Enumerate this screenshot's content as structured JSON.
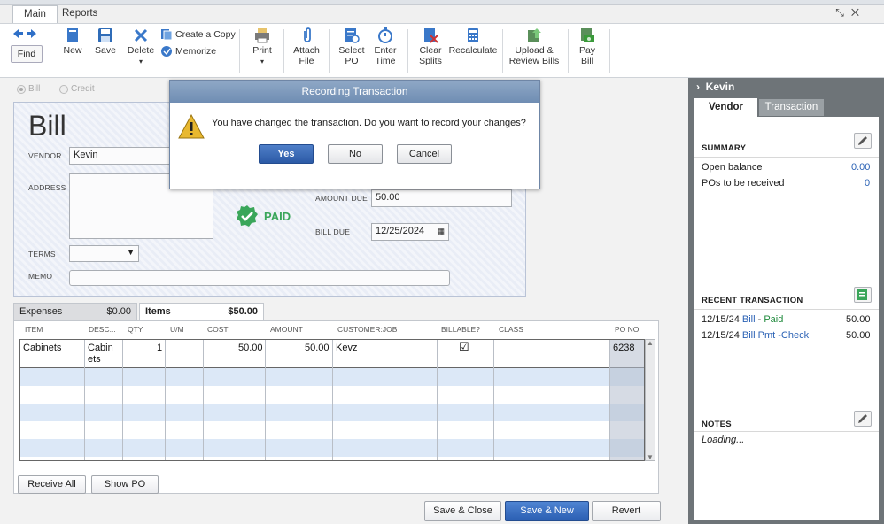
{
  "tabs": {
    "main": "Main",
    "reports": "Reports"
  },
  "toolbar": {
    "find": "Find",
    "new": "New",
    "save": "Save",
    "delete": "Delete",
    "create_copy": "Create a Copy",
    "memorize": "Memorize",
    "print": "Print",
    "attach_file": [
      "Attach",
      "File"
    ],
    "select_po": [
      "Select",
      "PO"
    ],
    "enter_time": [
      "Enter",
      "Time"
    ],
    "clear_splits": [
      "Clear",
      "Splits"
    ],
    "recalculate": "Recalculate",
    "upload_review": [
      "Upload &",
      "Review Bills"
    ],
    "pay_bill": [
      "Pay",
      "Bill"
    ]
  },
  "radios": {
    "bill": "Bill",
    "credit": "Credit"
  },
  "form": {
    "title": "Bill",
    "vendor_label": "VENDOR",
    "vendor_value": "Kevin",
    "address_label": "ADDRESS",
    "paid_stamp": "PAID",
    "amount_due_label": "AMOUNT DUE",
    "amount_due_value": "50.00",
    "bill_due_label": "BILL DUE",
    "bill_due_value": "12/25/2024",
    "terms_label": "TERMS",
    "memo_label": "MEMO"
  },
  "dialog": {
    "title": "Recording Transaction",
    "message": "You have changed the transaction. Do you want to record your changes?",
    "yes": "Yes",
    "no": "No",
    "cancel": "Cancel"
  },
  "subtabs": {
    "expenses_label": "Expenses",
    "expenses_amount": "$0.00",
    "items_label": "Items",
    "items_amount": "$50.00"
  },
  "grid": {
    "columns": [
      "ITEM",
      "DESC...",
      "QTY",
      "U/M",
      "COST",
      "AMOUNT",
      "CUSTOMER:JOB",
      "BILLABLE?",
      "CLASS",
      "PO NO."
    ],
    "row": {
      "item": "Cabinets",
      "desc_1": "Cabin",
      "desc_2": "ets",
      "qty": "1",
      "cost": "50.00",
      "amount": "50.00",
      "customer": "Kevz",
      "billable": "☑",
      "po": "6238"
    }
  },
  "bottom": {
    "receive_all": "Receive All",
    "show_po": "Show PO",
    "save_close": "Save & Close",
    "save_new": "Save & New",
    "revert": "Revert"
  },
  "panel": {
    "name": "Kevin",
    "tab_vendor": "Vendor",
    "tab_transaction": "Transaction",
    "summary_title": "SUMMARY",
    "open_balance_label": "Open balance",
    "open_balance_value": "0.00",
    "pos_label": "POs to be received",
    "pos_value": "0",
    "recent_title": "RECENT TRANSACTION",
    "recent": [
      {
        "date": "12/15/24",
        "type": "Bill",
        "sep": " - ",
        "status": "Paid",
        "amount": "50.00"
      },
      {
        "date": "12/15/24",
        "type": "Bill Pmt -Check",
        "amount": "50.00"
      }
    ],
    "notes_title": "NOTES",
    "notes_value": "Loading..."
  }
}
